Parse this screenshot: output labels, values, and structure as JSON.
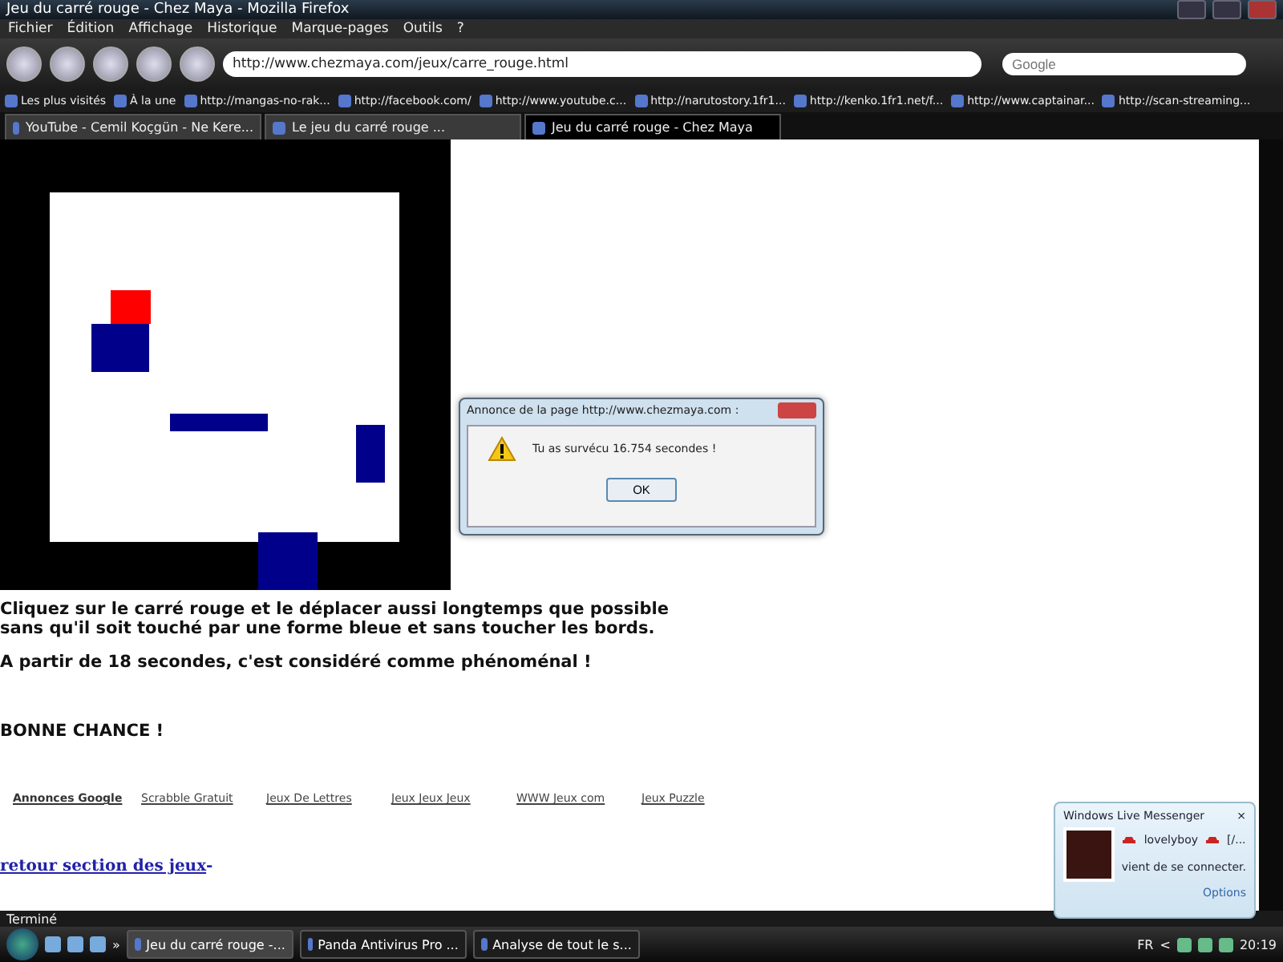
{
  "window": {
    "title": "Jeu du carré rouge - Chez Maya - Mozilla Firefox"
  },
  "menu": [
    "Fichier",
    "Édition",
    "Affichage",
    "Historique",
    "Marque-pages",
    "Outils",
    "?"
  ],
  "address_bar": {
    "value": "http://www.chezmaya.com/jeux/carre_rouge.html"
  },
  "search": {
    "placeholder": "Google"
  },
  "bookmarks": [
    "Les plus visités",
    "À la une",
    "http://mangas-no-rak...",
    "http://facebook.com/",
    "http://www.youtube.c...",
    "http://narutostory.1fr1...",
    "http://kenko.1fr1.net/f...",
    "http://www.captainar...",
    "http://scan-streaming..."
  ],
  "tabs": [
    {
      "label": "YouTube - Cemil Koçgün - Ne Kere...",
      "selected": false
    },
    {
      "label": "Le jeu du carré rouge ...",
      "selected": false
    },
    {
      "label": "Jeu du carré rouge - Chez Maya",
      "selected": true
    }
  ],
  "page": {
    "instructions": [
      "Cliquez sur le carré rouge et le déplacer aussi longtemps que possible",
      "sans qu'il soit touché par une forme bleue et sans toucher les bords."
    ],
    "note": "A partir de 18 secondes, c'est considéré comme phénoménal !",
    "good_luck": "BONNE CHANCE !",
    "ads_label": "Annonces Google",
    "ads": [
      "Scrabble Gratuit",
      "Jeux De Lettres",
      "Jeux Jeux Jeux",
      "WWW Jeux com",
      "Jeux Puzzle"
    ],
    "back_link": "retour section des jeux",
    "back_suffix": "-"
  },
  "dialog": {
    "title": "Annonce de la page  http://www.chezmaya.com  :",
    "message": "Tu as survécu 16.754 secondes !",
    "button": "OK"
  },
  "notification": {
    "app": "Windows Live Messenger",
    "close": "×",
    "user": "lovelyboy",
    "user_suffix": "[/...",
    "message": "vient de se connecter.",
    "options": "Options"
  },
  "status_bar": "Terminé",
  "taskbar": {
    "tasks": [
      {
        "label": "Jeu du carré rouge -...",
        "selected": true
      },
      {
        "label": "Panda Antivirus Pro ...",
        "selected": false
      },
      {
        "label": "Analyse de tout le s...",
        "selected": false
      }
    ],
    "more": "»",
    "language": "FR",
    "tray_toggle": "<",
    "clock": "20:19"
  }
}
